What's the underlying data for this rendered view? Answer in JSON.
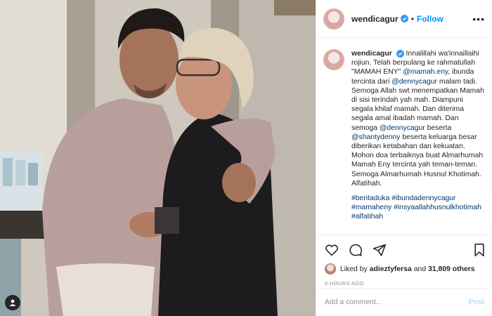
{
  "post": {
    "username": "wendicagur",
    "follow_label": "Follow",
    "dot": "•",
    "more_label": "•••",
    "caption": {
      "username": "wendicagur",
      "parts": [
        "Innalillahi wa'innaillaihi rojiun. Telah berpulang ke rahmatullah \"MAMAH ENY\" ",
        "@mamah.eny",
        ", ibunda tercinta dari ",
        "@dennycagur",
        " malam tadi. Semoga Allah swt menempatkan Mamah di sisi terindah yah mah. Diampuni segala khilaf mamah. Dan diterima segala amal ibadah mamah. Dan semoga ",
        "@dennycagur",
        " beserta ",
        "@shantydenny",
        " beserta keluarga besar diberikan ketabahan dan kekuatan. Mohon doa terbaiknya buat Almarhumah Mamah Eny tercinta yah teman-teman. Semoga Almarhumah Husnul Khotimah. Alfatihah."
      ],
      "hashtags": [
        "#beritaduka",
        "#ibundadennycagur",
        "#mamaheny",
        "#insyaallahhusnulkhotimah",
        "#alfatihah"
      ]
    },
    "likes": {
      "prefix": "Liked by ",
      "user": "adieztyfersa",
      "middle": " and ",
      "count": "31,809 others"
    },
    "time": "6 HOURS AGO",
    "comment_placeholder": "Add a comment...",
    "post_label": "Post"
  },
  "icons": {
    "verified": "verified-badge-icon",
    "like": "heart-icon",
    "comment": "comment-icon",
    "share": "paper-plane-icon",
    "save": "bookmark-icon",
    "tagged": "person-icon"
  },
  "colors": {
    "link": "#00376b",
    "follow": "#0095f6",
    "verified": "#3897f0",
    "muted": "#8e8e8e",
    "post_disabled": "#b2dffc"
  }
}
